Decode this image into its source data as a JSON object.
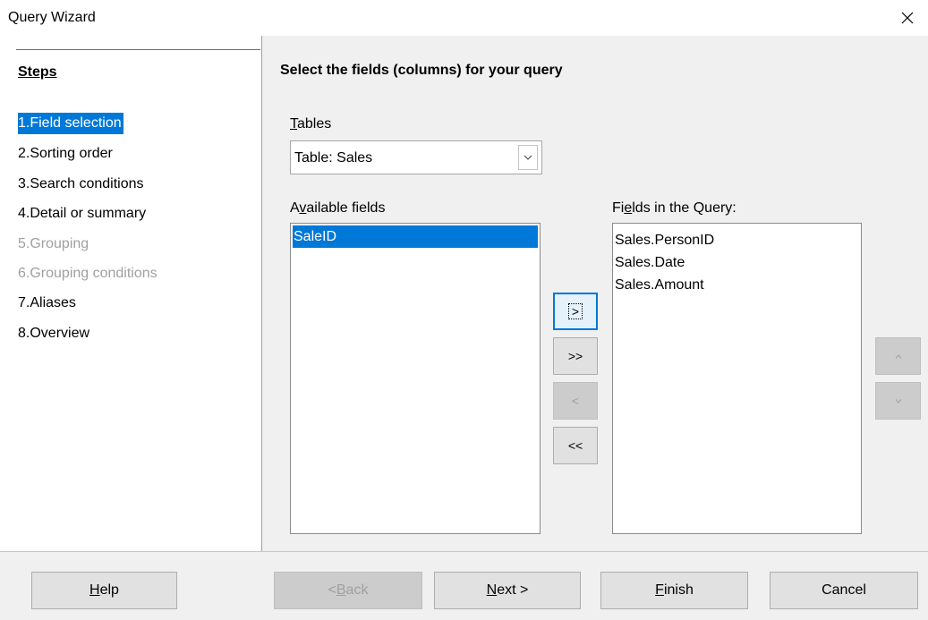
{
  "window": {
    "title": "Query Wizard",
    "close_glyph": "×"
  },
  "sidebar": {
    "heading": "Steps",
    "steps": [
      {
        "label": "1.Field selection",
        "state": "active"
      },
      {
        "label": "2.Sorting order",
        "state": "normal"
      },
      {
        "label": "3.Search conditions",
        "state": "normal"
      },
      {
        "label": "4.Detail or summary",
        "state": "normal"
      },
      {
        "label": "5.Grouping",
        "state": "disabled"
      },
      {
        "label": "6.Grouping conditions",
        "state": "disabled"
      },
      {
        "label": "7.Aliases",
        "state": "normal"
      },
      {
        "label": "8.Overview",
        "state": "normal"
      }
    ]
  },
  "main": {
    "title": "Select the fields (columns) for your query",
    "tables_label": "Tables",
    "tables_selected": "Table: Sales",
    "available_label": "Available fields",
    "available_fields": [
      "SaleID"
    ],
    "query_label": "Fields in the Query:",
    "query_fields": [
      "Sales.PersonID",
      "Sales.Date",
      "Sales.Amount"
    ],
    "move_buttons": {
      "add": ">",
      "add_all": ">>",
      "remove": "<",
      "remove_all": "<<"
    },
    "order_buttons": {
      "up": "^",
      "down": "v"
    }
  },
  "footer": {
    "help": "Help",
    "back": "< Back",
    "next": "Next >",
    "finish": "Finish",
    "cancel": "Cancel"
  },
  "colors": {
    "accent": "#0078d7",
    "disabled_text": "#a0a0a0"
  }
}
